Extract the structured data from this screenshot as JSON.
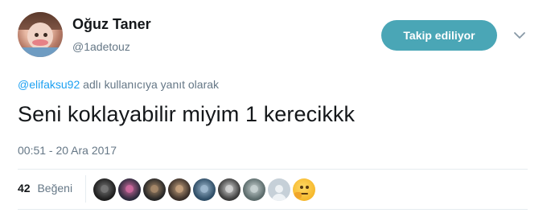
{
  "author": {
    "display_name": "Oğuz Taner",
    "username": "@1adetouz"
  },
  "follow_button": {
    "label": "Takip ediliyor",
    "color": "#4aa6b6"
  },
  "menu": {
    "icon": "chevron-down-icon"
  },
  "reply_context": {
    "mention": "@elifaksu92",
    "text": "adlı kullanıcıya yanıt olarak"
  },
  "tweet": {
    "text": "Seni koklayabilir miyim 1 kerecikkk",
    "timestamp": "00:51 - 20 Ara 2017"
  },
  "likes": {
    "count": "42",
    "label": "Beğeni",
    "avatars": [
      {
        "kind": "photo",
        "bg": "#1e1e1e",
        "accent": "#777777"
      },
      {
        "kind": "photo",
        "bg": "#2b2a3c",
        "accent": "#cf6aa0"
      },
      {
        "kind": "photo",
        "bg": "#262626",
        "accent": "#a88a6a"
      },
      {
        "kind": "photo",
        "bg": "#3a2f29",
        "accent": "#c7a37f"
      },
      {
        "kind": "photo",
        "bg": "#2e4d66",
        "accent": "#9fb9cf"
      },
      {
        "kind": "photo",
        "bg": "#3b3b3b",
        "accent": "#d5d5d5"
      },
      {
        "kind": "photo",
        "bg": "#5a6a6a",
        "accent": "#c9d3d3"
      },
      {
        "kind": "default",
        "bg": "#c6d0d8",
        "accent": "#eef2f5"
      },
      {
        "kind": "emoji",
        "bg": "#f6b82b",
        "accent": "#5a3a10"
      }
    ]
  },
  "colors": {
    "text": "#14171a",
    "secondary": "#657786",
    "link": "#1da1f2",
    "divider": "#e6ecf0"
  }
}
